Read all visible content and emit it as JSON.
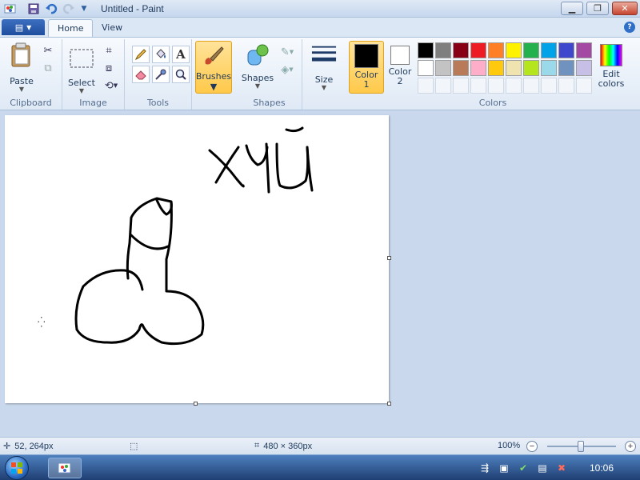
{
  "window": {
    "title": "Untitled - Paint",
    "qat_icons": [
      "paint-app-icon",
      "save-icon",
      "undo-icon",
      "redo-icon",
      "customize-qat-icon"
    ],
    "controls": [
      "minimize-icon",
      "restore-icon",
      "close-icon"
    ]
  },
  "tabs": {
    "file_icon": "paint-menu-icon",
    "home": "Home",
    "view": "View"
  },
  "ribbon": {
    "clipboard": {
      "paste": "Paste",
      "label": "Clipboard"
    },
    "image": {
      "select": "Select",
      "label": "Image"
    },
    "tools": {
      "label": "Tools",
      "items": [
        "pencil-icon",
        "fill-icon",
        "text-icon",
        "eraser-icon",
        "color-picker-icon",
        "magnifier-icon"
      ]
    },
    "brushes": {
      "label": "Brushes"
    },
    "shapes": {
      "shapes": "Shapes",
      "label": "Shapes"
    },
    "size": {
      "label": "Size"
    },
    "colors": {
      "label": "Colors",
      "color1": {
        "title": "Color",
        "num": "1",
        "value": "#000000"
      },
      "color2": {
        "title": "Color",
        "num": "2",
        "value": "#ffffff"
      },
      "palette": [
        "#000000",
        "#7f7f7f",
        "#880015",
        "#ed1c24",
        "#ff7f27",
        "#fff200",
        "#22b14c",
        "#00a2e8",
        "#3f48cc",
        "#a349a4",
        "#ffffff",
        "#c3c3c3",
        "#b97a57",
        "#ffaec9",
        "#ffc90e",
        "#efe4b0",
        "#b5e61d",
        "#99d9ea",
        "#7092be",
        "#c8bfe7"
      ],
      "edit_colors_line1": "Edit",
      "edit_colors_line2": "colors"
    }
  },
  "canvas": {
    "background": "#ffffff",
    "ink": "#000000"
  },
  "status": {
    "cursor_pos": "52, 264px",
    "canvas_size": "480 × 360px",
    "zoom": "100%"
  },
  "taskbar": {
    "clock": "10:06"
  }
}
